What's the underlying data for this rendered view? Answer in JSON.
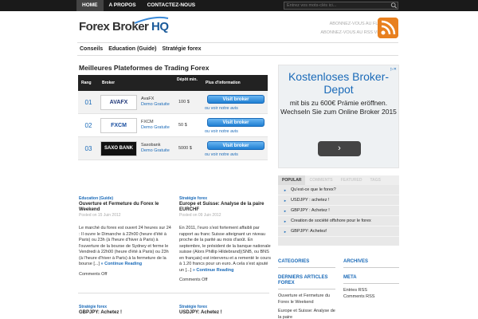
{
  "topnav": {
    "items": [
      "HOME",
      "A PROPOS",
      "CONTACTEZ-NOUS"
    ]
  },
  "search": {
    "placeholder": "Entrez vos mots-clés ici..."
  },
  "logo": {
    "text_main": "Forex Broker ",
    "text_hq": "HQ"
  },
  "rss": {
    "feed": "ABONNEZ-VOUS AU FLUX RSS !",
    "email": "ABONNEZ-VOUS AU RSS VIA E-MAIL"
  },
  "mainnav": {
    "items": [
      "Conseils",
      "Education (Guide)",
      "Stratégie forex"
    ]
  },
  "page_title": "Meilleures Plateformes de Trading Forex",
  "table": {
    "headers": {
      "rang": "Rang",
      "broker": "Broker",
      "depot": "Dépôt min.",
      "info": "Plus d'information"
    },
    "rows": [
      {
        "rank": "01",
        "logo": "AVAFX",
        "name": "AvaFX",
        "demo": "Demo Gratuite",
        "depot": "100 $",
        "button": "Visit broker",
        "more": "ou voir notre avis"
      },
      {
        "rank": "02",
        "logo": "FXCM",
        "name": "FXCM",
        "demo": "Demo Gratuite",
        "depot": "50 $",
        "button": "Visit broker",
        "more": "ou voir notre avis"
      },
      {
        "rank": "03",
        "logo": "SAXO BANK",
        "name": "Saxobank",
        "demo": "Demo Gratuite",
        "depot": "5000 $",
        "button": "Visit broker",
        "more": "ou voir notre avis"
      }
    ]
  },
  "posts": [
    {
      "cat": "Education (Guide)",
      "title": "Ouverture et Fermeture du Forex le Weekend",
      "meta": "Posted on 15 Juin 2012",
      "excerpt": "Le marché du forex est ouvert 24 heures sur 24 : Il ouvre le Dimanche à 22h00 (heure d'été à Paris) ou 23h (à l'heure d'hiver à Paris) à l'ouverture de la bourse de Sydney et ferme le Vendredi à 22h00 (heure d'été à Paris) ou 23h (à l'heure d'hiver à Paris) à la fermeture de la bourse [...] ",
      "cont": "» Continue Reading",
      "comments": "Comments Off"
    },
    {
      "cat": "Stratégie forex",
      "title": "Europe et Suisse: Analyse de la paire EURCHF",
      "meta": "Posted on 09 Juin 2012",
      "excerpt": "En 2011, l'euro s'est fortement affaibli par rapport au franc Suisse atteignant un niveau proche de la parité au mois d'août. En septembre, le président de la banque nationale suisse (Alors Phillip Hildebrand)(SNB, ou BNS en français) est intervenu et a rementé le cours à 1.20 francs pour un euro. A cela s'est ajouté un [...] ",
      "cont": "» Continue Reading",
      "comments": "Comments Off"
    },
    {
      "cat": "Stratégie forex",
      "title": "GBPJPY: Achetez !"
    },
    {
      "cat": "Stratégie forex",
      "title": "USDJPY: Achetez !"
    }
  ],
  "ad": {
    "headline": "Kostenloses Broker-Depot",
    "text": "mit bis zu 600€ Prämie eröffnen. Wechseln Sie zum Online Broker 2015",
    "arrow": "›"
  },
  "tabs": {
    "labels": [
      "POPULAR",
      "COMMENTS",
      "FEATURED",
      "TAGS"
    ],
    "items": [
      "Qu'est-ce que le forex?",
      "USDJPY : achetez !",
      "GBPJPY : Achetez !",
      "Creation de société offshore pour le forex",
      "GBPJPY: Achetez!"
    ]
  },
  "widgets": {
    "categories": {
      "title": "CATEGORIES"
    },
    "archives": {
      "title": "ARCHIVES"
    },
    "derniers": {
      "title": "DERNIERS ARTICLES FOREX",
      "items": [
        "Ouverture et Fermeture du Forex le Weekend",
        "Europe et Suisse: Analyse de la paire"
      ]
    },
    "meta": {
      "title": "META",
      "items": [
        "Entries RSS",
        "Comments RSS"
      ]
    }
  },
  "colors": {
    "accent": "#1a6ab8",
    "topbar": "#1a1a1a",
    "rss": "#e8801f"
  }
}
